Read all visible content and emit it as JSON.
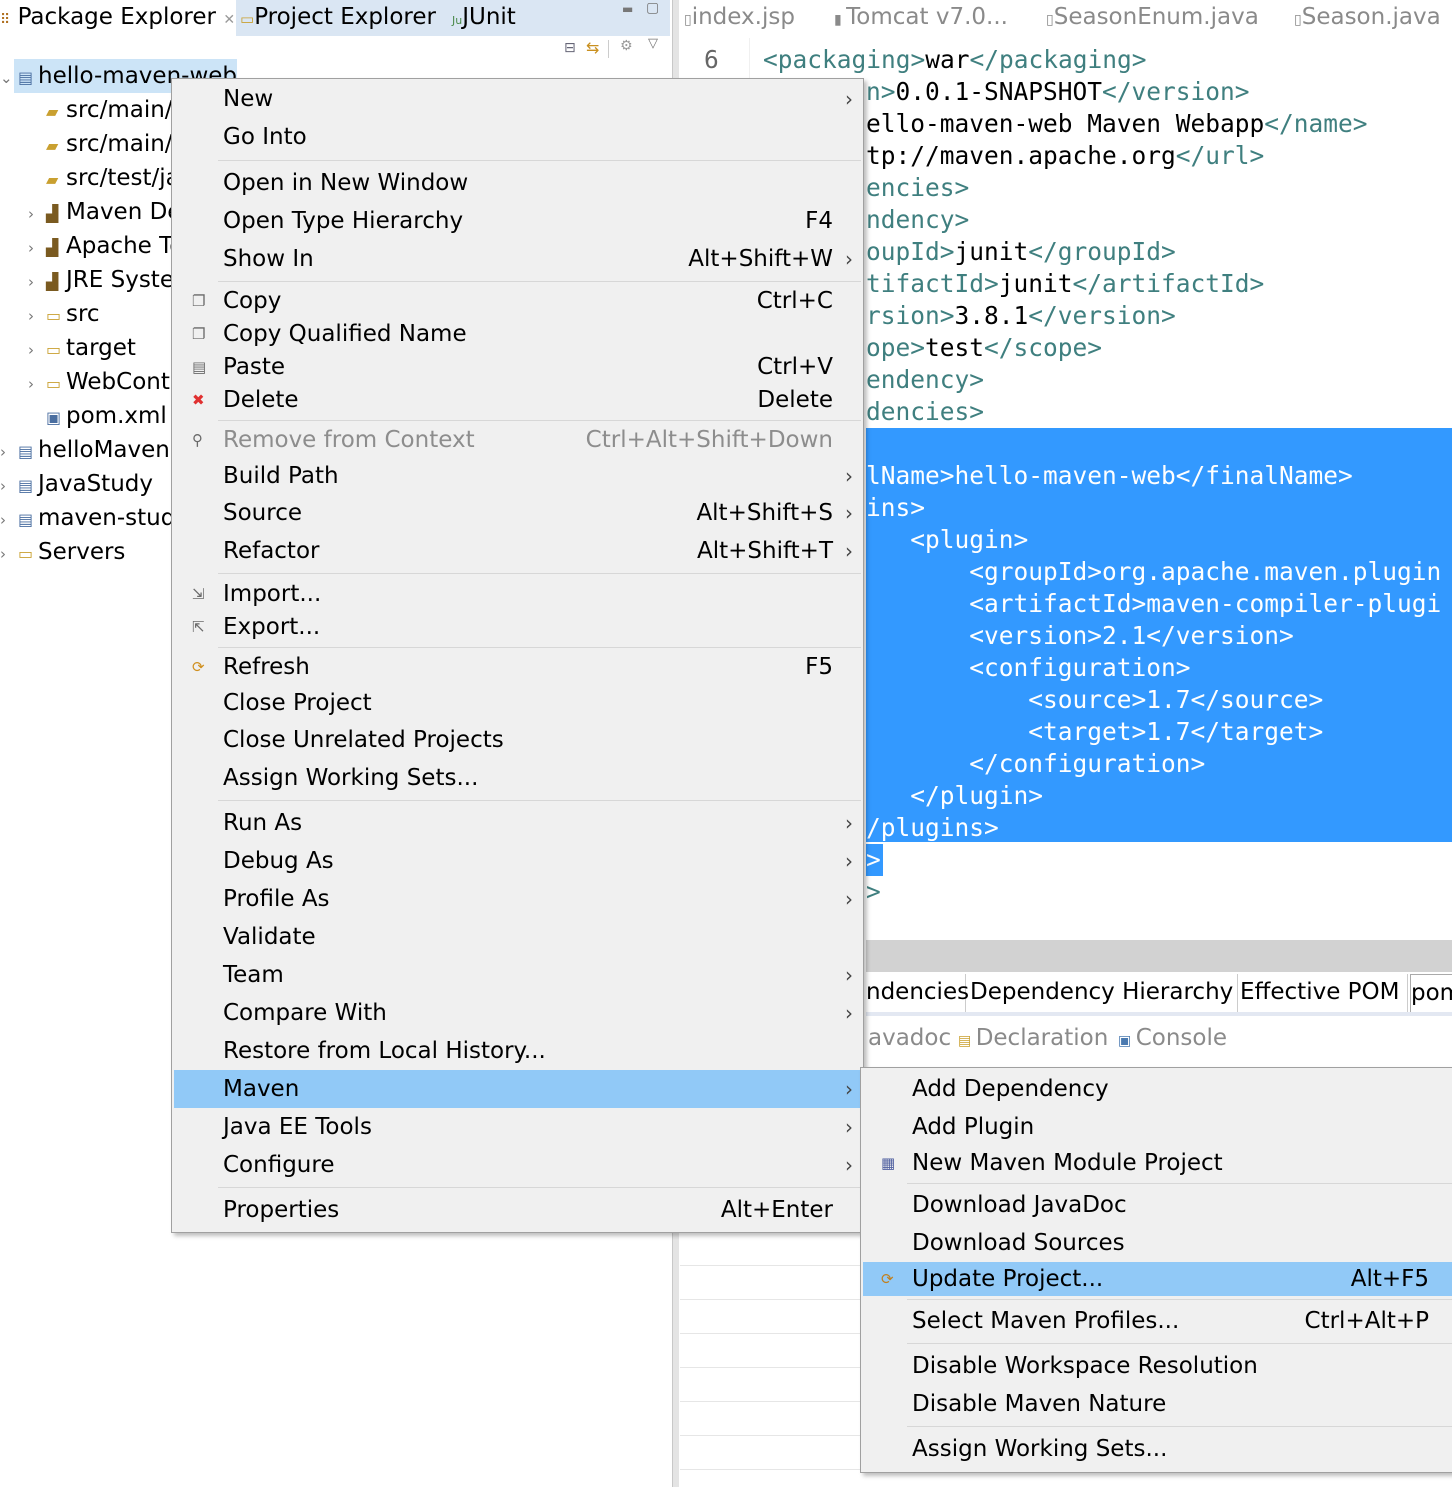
{
  "left_panel": {
    "tabs": [
      {
        "label": "Package Explorer",
        "icon": "package-icon",
        "close": "✕"
      },
      {
        "label": "Project Explorer",
        "icon": "folder-icon"
      },
      {
        "label": "JUnit",
        "icon": "junit-icon"
      }
    ],
    "tree": [
      {
        "label": "hello-maven-web",
        "level": 0,
        "expanded": true,
        "selected": true,
        "icon": "project-icon"
      },
      {
        "label": "src/main/j",
        "level": 1,
        "icon": "source-folder-icon"
      },
      {
        "label": "src/main/r",
        "level": 1,
        "icon": "source-folder-icon"
      },
      {
        "label": "src/test/ja",
        "level": 1,
        "icon": "source-folder-icon"
      },
      {
        "label": "Maven De",
        "level": 1,
        "expandable": true,
        "icon": "library-icon"
      },
      {
        "label": "Apache To",
        "level": 1,
        "expandable": true,
        "icon": "library-icon"
      },
      {
        "label": "JRE Syster",
        "level": 1,
        "expandable": true,
        "icon": "library-icon"
      },
      {
        "label": "src",
        "level": 1,
        "expandable": true,
        "icon": "folder-icon"
      },
      {
        "label": "target",
        "level": 1,
        "expandable": true,
        "icon": "folder-icon"
      },
      {
        "label": "WebConte",
        "level": 1,
        "expandable": true,
        "icon": "folder-icon"
      },
      {
        "label": "pom.xml",
        "level": 1,
        "icon": "xml-file-icon"
      },
      {
        "label": "helloMaven",
        "level": 0,
        "expandable": true,
        "icon": "project-icon"
      },
      {
        "label": "JavaStudy",
        "level": 0,
        "expandable": true,
        "icon": "project-icon"
      },
      {
        "label": "maven-stud",
        "level": 0,
        "expandable": true,
        "icon": "project-icon"
      },
      {
        "label": "Servers",
        "level": 0,
        "expandable": true,
        "icon": "folder-icon"
      }
    ]
  },
  "editor": {
    "tabs": [
      "index.jsp",
      "Tomcat v7.0...",
      "SeasonEnum.java",
      "Season.java"
    ],
    "line_number": "6",
    "lines": [
      [
        [
          "tg",
          "<packaging>"
        ],
        [
          "tx",
          "war"
        ],
        [
          "tg",
          "</packaging>"
        ]
      ],
      [
        [
          "tg",
          "n>"
        ],
        [
          "tx",
          "0.0.1-SNAPSHOT"
        ],
        [
          "tg",
          "</version>"
        ]
      ],
      [
        [
          "tx",
          "ello-maven-web Maven Webapp"
        ],
        [
          "tg",
          "</name>"
        ]
      ],
      [
        [
          "tx",
          "tp://maven.apache.org"
        ],
        [
          "tg",
          "</url>"
        ]
      ],
      [
        [
          "tg",
          "encies>"
        ]
      ],
      [
        [
          "tg",
          "ndency>"
        ]
      ],
      [
        [
          "tg",
          "oupId>"
        ],
        [
          "tx",
          "junit"
        ],
        [
          "tg",
          "</groupId>"
        ]
      ],
      [
        [
          "tg",
          "tifactId>"
        ],
        [
          "tx",
          "junit"
        ],
        [
          "tg",
          "</artifactId>"
        ]
      ],
      [
        [
          "tg",
          "rsion>"
        ],
        [
          "tx",
          "3.8.1"
        ],
        [
          "tg",
          "</version>"
        ]
      ],
      [
        [
          "tg",
          "ope>"
        ],
        [
          "tx",
          "test"
        ],
        [
          "tg",
          "</scope>"
        ]
      ],
      [
        [
          "tg",
          "endency>"
        ]
      ],
      [
        [
          "tg",
          "dencies>"
        ]
      ],
      [],
      [
        [
          "tg",
          "lName>"
        ],
        [
          "tx",
          "hello-maven-web"
        ],
        [
          "tg",
          "</finalName>"
        ]
      ],
      [
        [
          "tg",
          "ins>"
        ]
      ],
      [
        [
          "tg",
          "   <plugin>"
        ]
      ],
      [
        [
          "tg",
          "       <groupId>"
        ],
        [
          "tx",
          "org.apache.maven.plugin"
        ]
      ],
      [
        [
          "tg",
          "       <artifactId>"
        ],
        [
          "tx",
          "maven-compiler-plugi"
        ]
      ],
      [
        [
          "tg",
          "       <version>"
        ],
        [
          "tx",
          "2.1"
        ],
        [
          "tg",
          "</version>"
        ]
      ],
      [
        [
          "tg",
          "       <configuration>"
        ]
      ],
      [
        [
          "tg",
          "           <source>"
        ],
        [
          "tx",
          "1.7"
        ],
        [
          "tg",
          "</source>"
        ]
      ],
      [
        [
          "tg",
          "           <target>"
        ],
        [
          "tx",
          "1.7"
        ],
        [
          "tg",
          "</target>"
        ]
      ],
      [
        [
          "tg",
          "       </configuration>"
        ]
      ],
      [
        [
          "tg",
          "   </plugin>"
        ]
      ],
      [
        [
          "tg",
          "/plugins>"
        ]
      ],
      [
        [
          "tg",
          ">"
        ]
      ],
      [
        [
          "tg",
          ">"
        ]
      ]
    ],
    "selection_color": "#3399ff",
    "pom_tabs": [
      "ndencies",
      "Dependency Hierarchy",
      "Effective POM",
      "pom"
    ],
    "view_tabs": [
      {
        "label": "avadoc"
      },
      {
        "label": "Declaration",
        "icon": "declaration-icon"
      },
      {
        "label": "Console",
        "icon": "console-icon"
      }
    ]
  },
  "context_menu": [
    {
      "label": "New",
      "arrow": true
    },
    {
      "label": "Go Into"
    },
    {
      "sep": true
    },
    {
      "label": "Open in New Window"
    },
    {
      "label": "Open Type Hierarchy",
      "shortcut": "F4"
    },
    {
      "label": "Show In",
      "shortcut": "Alt+Shift+W",
      "arrow": true
    },
    {
      "sep": true
    },
    {
      "label": "Copy",
      "shortcut": "Ctrl+C",
      "icon": "copy-icon"
    },
    {
      "label": "Copy Qualified Name",
      "icon": "copy-qualified-icon"
    },
    {
      "label": "Paste",
      "shortcut": "Ctrl+V",
      "icon": "paste-icon"
    },
    {
      "label": "Delete",
      "shortcut": "Delete",
      "icon": "delete-icon"
    },
    {
      "sep": true
    },
    {
      "label": "Remove from Context",
      "shortcut": "Ctrl+Alt+Shift+Down",
      "disabled": true,
      "icon": "remove-context-icon"
    },
    {
      "label": "Build Path",
      "arrow": true
    },
    {
      "label": "Source",
      "shortcut": "Alt+Shift+S",
      "arrow": true
    },
    {
      "label": "Refactor",
      "shortcut": "Alt+Shift+T",
      "arrow": true
    },
    {
      "sep": true
    },
    {
      "label": "Import...",
      "icon": "import-icon"
    },
    {
      "label": "Export...",
      "icon": "export-icon"
    },
    {
      "sep": true
    },
    {
      "label": "Refresh",
      "shortcut": "F5",
      "icon": "refresh-icon"
    },
    {
      "label": "Close Project"
    },
    {
      "label": "Close Unrelated Projects"
    },
    {
      "label": "Assign Working Sets..."
    },
    {
      "sep": true
    },
    {
      "label": "Run As",
      "arrow": true
    },
    {
      "label": "Debug As",
      "arrow": true
    },
    {
      "label": "Profile As",
      "arrow": true
    },
    {
      "label": "Validate"
    },
    {
      "label": "Team",
      "arrow": true
    },
    {
      "label": "Compare With",
      "arrow": true
    },
    {
      "label": "Restore from Local History..."
    },
    {
      "label": "Maven",
      "arrow": true,
      "highlighted": true
    },
    {
      "label": "Java EE Tools",
      "arrow": true
    },
    {
      "label": "Configure",
      "arrow": true
    },
    {
      "sep": true
    },
    {
      "label": "Properties",
      "shortcut": "Alt+Enter"
    }
  ],
  "maven_submenu": [
    {
      "label": "Add Dependency"
    },
    {
      "label": "Add Plugin"
    },
    {
      "label": "New Maven Module Project",
      "icon": "maven-module-icon"
    },
    {
      "sep": true
    },
    {
      "label": "Download JavaDoc"
    },
    {
      "label": "Download Sources"
    },
    {
      "label": "Update Project...",
      "shortcut": "Alt+F5",
      "highlighted": true,
      "icon": "update-project-icon"
    },
    {
      "sep": true
    },
    {
      "label": "Select Maven Profiles...",
      "shortcut": "Ctrl+Alt+P"
    },
    {
      "sep": true
    },
    {
      "label": "Disable Workspace Resolution"
    },
    {
      "label": "Disable Maven Nature"
    },
    {
      "sep": true
    },
    {
      "label": "Assign Working Sets..."
    }
  ]
}
